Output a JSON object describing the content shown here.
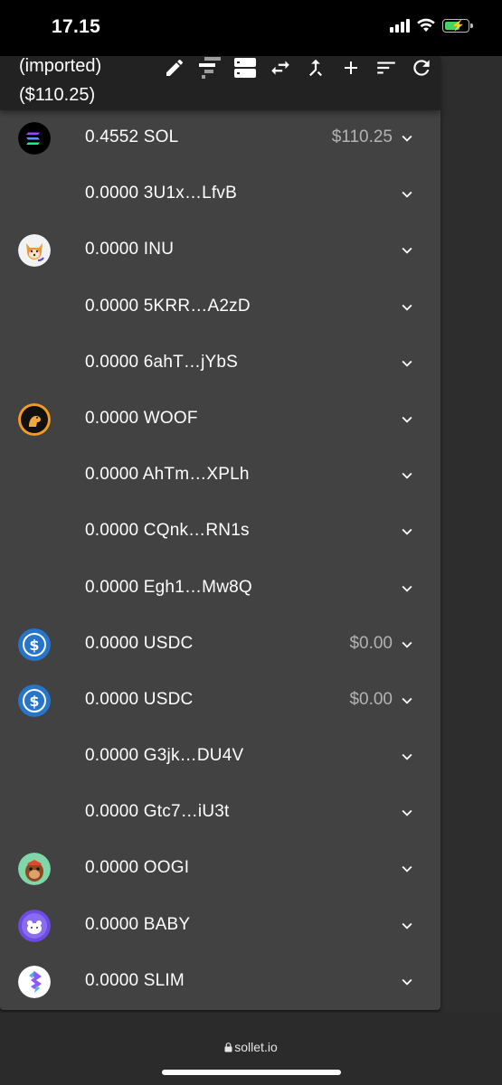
{
  "status_bar": {
    "time": "17.15"
  },
  "header": {
    "account_line": "(imported)",
    "balance_line": "($110.25)",
    "toolbar_icons": [
      "edit-icon",
      "deposit-icon",
      "view-list-icon",
      "swap-icon",
      "merge-icon",
      "add-icon",
      "sort-icon",
      "refresh-icon"
    ]
  },
  "tokens": [
    {
      "text": "0.4552 SOL",
      "usd": "$110.25",
      "icon": "solana-logo"
    },
    {
      "text": "0.0000 3U1x…LfvB",
      "usd": "",
      "icon": ""
    },
    {
      "text": "0.0000 INU",
      "usd": "",
      "icon": "inu-logo"
    },
    {
      "text": "0.0000 5KRR…A2zD",
      "usd": "",
      "icon": ""
    },
    {
      "text": "0.0000 6ahT…jYbS",
      "usd": "",
      "icon": ""
    },
    {
      "text": "0.0000 WOOF",
      "usd": "",
      "icon": "woof-logo"
    },
    {
      "text": "0.0000 AhTm…XPLh",
      "usd": "",
      "icon": ""
    },
    {
      "text": "0.0000 CQnk…RN1s",
      "usd": "",
      "icon": ""
    },
    {
      "text": "0.0000 Egh1…Mw8Q",
      "usd": "",
      "icon": ""
    },
    {
      "text": "0.0000 USDC",
      "usd": "$0.00",
      "icon": "usdc-logo"
    },
    {
      "text": "0.0000 USDC",
      "usd": "$0.00",
      "icon": "usdc-logo"
    },
    {
      "text": "0.0000 G3jk…DU4V",
      "usd": "",
      "icon": ""
    },
    {
      "text": "0.0000 Gtc7…iU3t",
      "usd": "",
      "icon": ""
    },
    {
      "text": "0.0000 OOGI",
      "usd": "",
      "icon": "oogi-logo"
    },
    {
      "text": "0.0000 BABY",
      "usd": "",
      "icon": "baby-logo"
    },
    {
      "text": "0.0000 SLIM",
      "usd": "",
      "icon": "slim-logo"
    }
  ],
  "browser": {
    "url": "sollet.io"
  },
  "colors": {
    "panel": "#424242",
    "header": "#222222",
    "usd_text": "#b3b3b3",
    "usdc_blue": "#2775ca"
  }
}
